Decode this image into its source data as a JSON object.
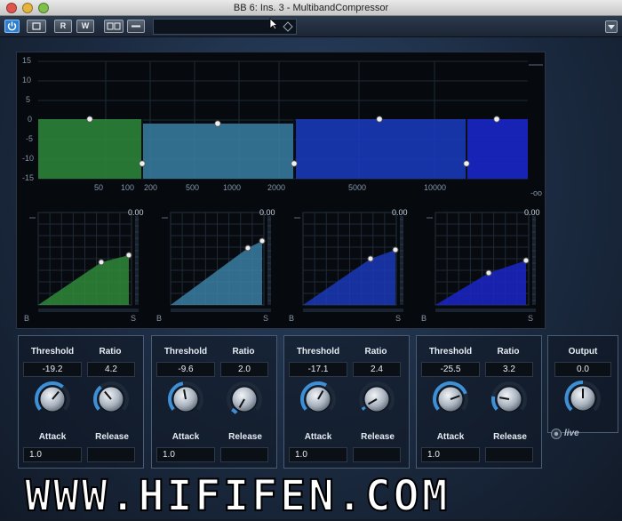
{
  "window": {
    "title": "BB 6: Ins. 3 - MultibandCompressor"
  },
  "toolbar": {
    "button_labels": [
      "R",
      "W"
    ],
    "icons": [
      "power-icon",
      "compare-icon",
      "read-icon",
      "write-icon",
      "ab-icon",
      "preset-menu-icon",
      "settings-dropdown-icon"
    ]
  },
  "display": {
    "db_ticks": [
      "15",
      "10",
      "5",
      "0",
      "-5",
      "-10",
      "-15"
    ],
    "freq_ticks": [
      "50",
      "100",
      "200",
      "500",
      "1000",
      "2000",
      "5000",
      "10000"
    ],
    "right_label": "-oo",
    "bands": [
      {
        "color": "#2f8a3a"
      },
      {
        "color": "#3a7fa3"
      },
      {
        "color": "#1a39b8"
      },
      {
        "color": "#1a26c8"
      }
    ]
  },
  "curves": [
    {
      "peak": "0.00",
      "left": "B",
      "right": "S"
    },
    {
      "peak": "0.00",
      "left": "B",
      "right": "S"
    },
    {
      "peak": "0.00",
      "left": "B",
      "right": "S"
    },
    {
      "peak": "0.00",
      "left": "B",
      "right": "S"
    }
  ],
  "band_controls": [
    {
      "threshold_label": "Threshold",
      "threshold": "-19.2",
      "ratio_label": "Ratio",
      "ratio": "4.2",
      "attack_label": "Attack",
      "attack": "1.0",
      "release_label": "Release"
    },
    {
      "threshold_label": "Threshold",
      "threshold": "-9.6",
      "ratio_label": "Ratio",
      "ratio": "2.0",
      "attack_label": "Attack",
      "attack": "1.0",
      "release_label": "Release"
    },
    {
      "threshold_label": "Threshold",
      "threshold": "-17.1",
      "ratio_label": "Ratio",
      "ratio": "2.4",
      "attack_label": "Attack",
      "attack": "1.0",
      "release_label": "Release"
    },
    {
      "threshold_label": "Threshold",
      "threshold": "-25.5",
      "ratio_label": "Ratio",
      "ratio": "3.2",
      "attack_label": "Attack",
      "attack": "1.0",
      "release_label": "Release"
    }
  ],
  "output": {
    "label": "Output",
    "value": "0.0",
    "live_label": "live"
  },
  "watermark": "WWW.HIFIFEN.COM"
}
